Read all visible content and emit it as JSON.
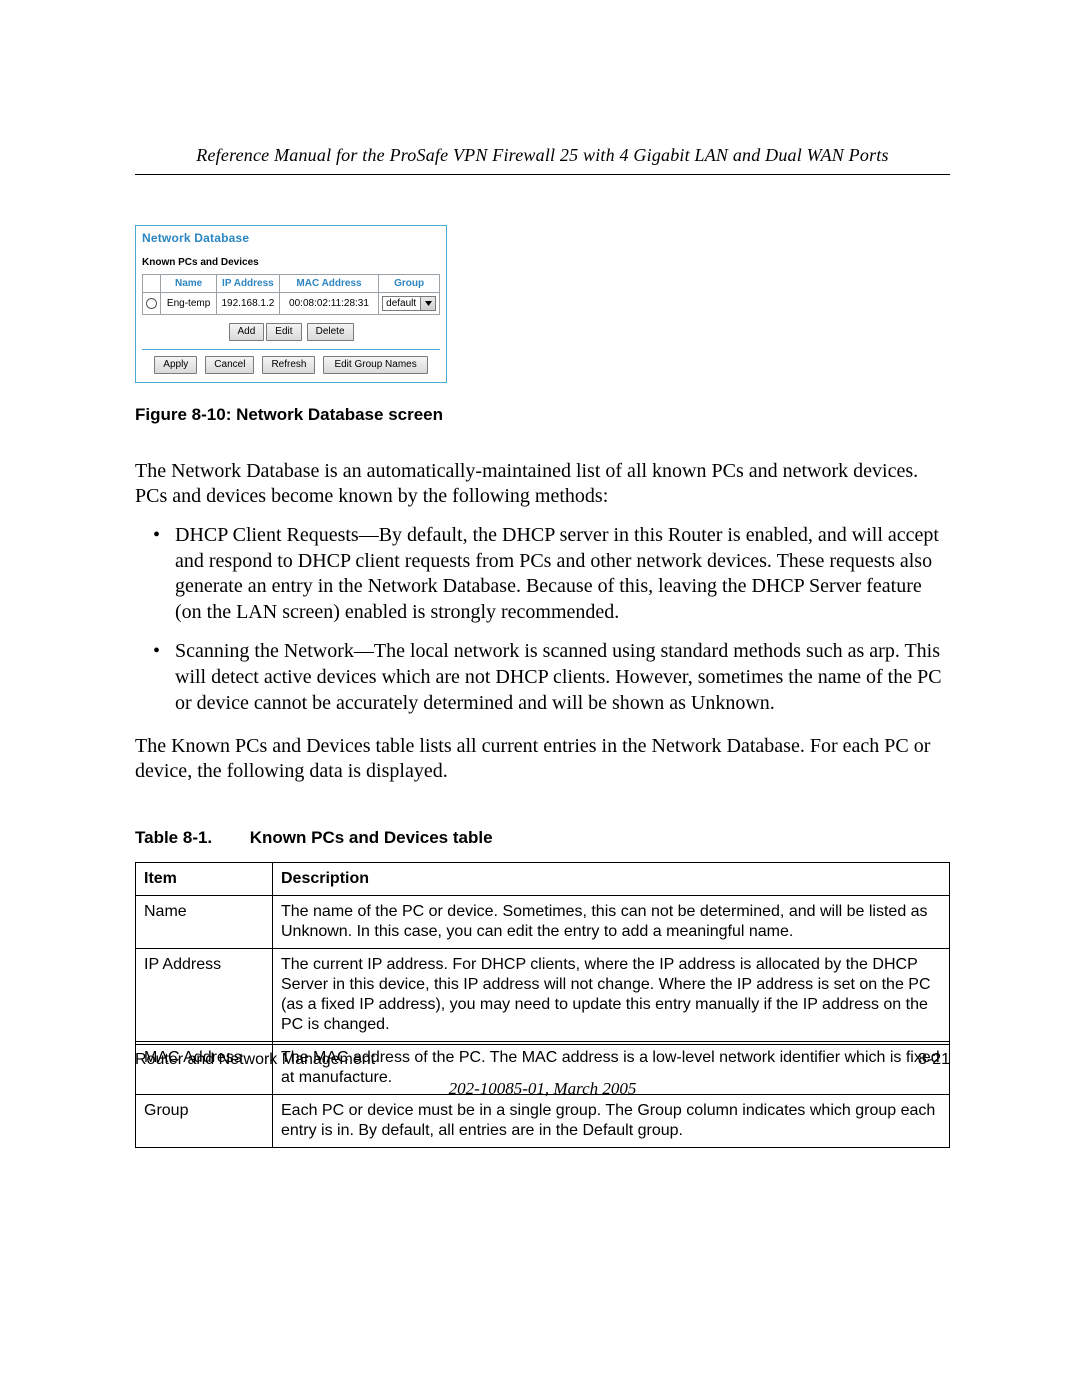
{
  "header": {
    "title": "Reference Manual for the ProSafe VPN Firewall 25 with 4 Gigabit LAN and Dual WAN Ports"
  },
  "screenshot": {
    "panel_title": "Network Database",
    "subtitle": "Known PCs and Devices",
    "columns": {
      "name": "Name",
      "ip": "IP Address",
      "mac": "MAC Address",
      "group": "Group"
    },
    "row": {
      "name": "Eng-temp",
      "ip": "192.168.1.2",
      "mac": "00:08:02:11:28:31",
      "group": "default"
    },
    "buttons_row1": {
      "add": "Add",
      "edit": "Edit",
      "delete": "Delete"
    },
    "buttons_row2": {
      "apply": "Apply",
      "cancel": "Cancel",
      "refresh": "Refresh",
      "edit_groups": "Edit Group Names"
    }
  },
  "figure_caption": "Figure 8-10:  Network Database screen",
  "paragraphs": {
    "p1": "The Network Database is an automatically-maintained list of all known PCs and network devices. PCs and devices become known by the following methods:",
    "p2": "The Known PCs and Devices table lists all current entries in the Network Database. For each PC or device, the following data is displayed."
  },
  "bullets": [
    "DHCP Client Requests—By default, the DHCP server in this Router is enabled, and will accept and respond to DHCP client requests from PCs and other network devices. These requests also generate an entry in the Network Database. Because of this, leaving the DHCP Server feature (on the LAN screen) enabled is strongly recommended.",
    "Scanning the Network—The local network is scanned using standard methods such as arp. This will detect active devices which are not DHCP clients. However, sometimes the name of the PC or device cannot be accurately determined and will be shown as Unknown."
  ],
  "table_caption": {
    "number": "Table 8-1.",
    "title": "Known PCs and Devices table"
  },
  "desc_table": {
    "headers": {
      "item": "Item",
      "desc": "Description"
    },
    "rows": [
      {
        "item": "Name",
        "desc": "The name of the PC or device. Sometimes, this can not be determined, and will be listed as Unknown. In this case, you can edit the entry to add a meaningful name."
      },
      {
        "item": "IP Address",
        "desc": "The current IP address. For DHCP clients, where the IP address is allocated by the DHCP Server in this device, this IP address will not change. Where the IP address is set on the PC (as a fixed IP address), you may need to update this entry manually if the IP address on the PC is changed."
      },
      {
        "item": "MAC Address",
        "desc": "The MAC address of the PC. The MAC address is a low-level network identifier which is fixed at manufacture."
      },
      {
        "item": "Group",
        "desc": "Each PC or device must be in a single group. The Group column indicates which group each entry is in. By default, all entries are in the Default group."
      }
    ]
  },
  "footer": {
    "section": "Router and Network Management",
    "page": "8-21",
    "docnum": "202-10085-01, March 2005"
  }
}
